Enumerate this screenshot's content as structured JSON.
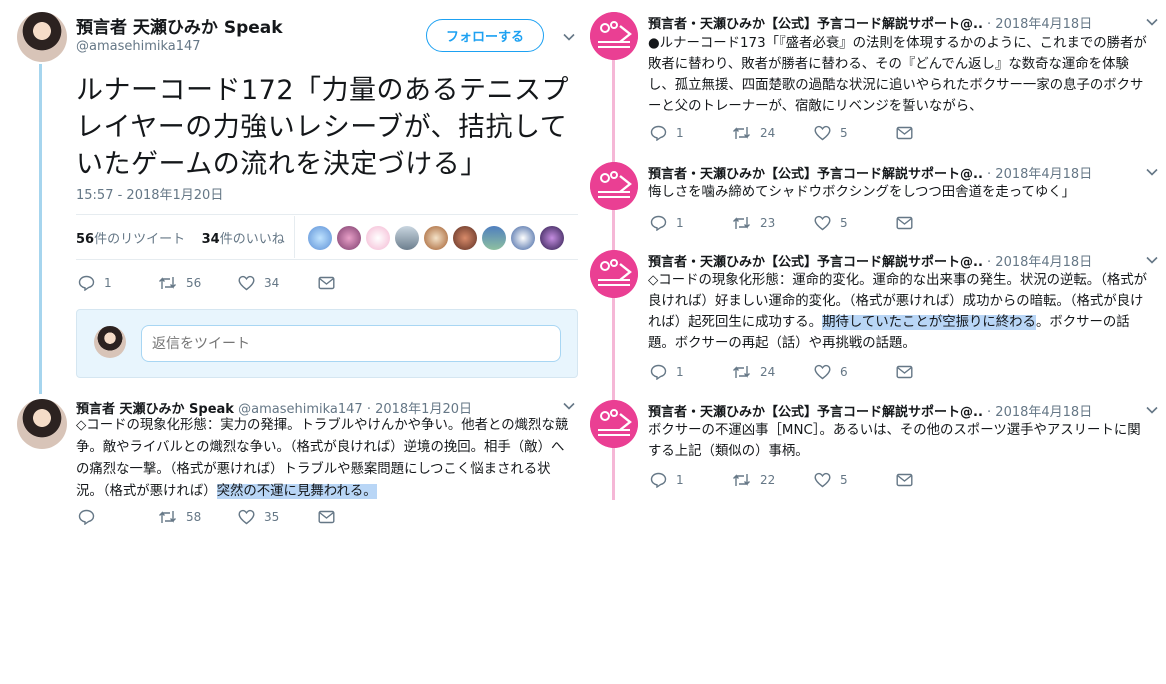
{
  "main_tweet": {
    "author_name": "預言者 天瀬ひみか Speak",
    "handle": "@amasehimika147",
    "follow_label": "フォローする",
    "text": "ルナーコード172「力量のあるテニスプレイヤーの力強いレシーブが、拮抗していたゲームの流れを決定づける」",
    "timestamp": "15:57 - 2018年1月20日",
    "retweet_count": "56",
    "retweet_label": "件のリツイート",
    "like_count": "34",
    "like_label": "件のいいね",
    "actions": {
      "reply": "1",
      "retweet": "56",
      "like": "34"
    }
  },
  "reply_box": {
    "placeholder": "返信をツイート"
  },
  "reply_tweet": {
    "author_name": "預言者 天瀬ひみか Speak",
    "handle": "@amasehimika147",
    "date": "· 2018年1月20日",
    "text_plain": "◇コードの現象化形態：実力の発揮。トラブルやけんかや争い。他者との熾烈な競争。敵やライバルとの熾烈な争い。（格式が良ければ）逆境の挽回。相手（敵）への痛烈な一撃。（格式が悪ければ）トラブルや懸案問題にしつこく悩まされる状況。（格式が悪ければ）",
    "text_highlight": "突然の不運に見舞われる。",
    "actions": {
      "reply": "",
      "retweet": "58",
      "like": "35"
    }
  },
  "right_tweets": [
    {
      "author_name": "預言者・天瀬ひみか【公式】予言コード解説サポート@..",
      "date": "· 2018年4月18日",
      "text_plain": "●ルナーコード173「『盛者必衰』の法則を体現するかのように、これまでの勝者が敗者に替わり、敗者が勝者に替わる、その『どんでん返し』な数奇な運命を体験し、孤立無援、四面楚歌の過酷な状況に追いやられたボクサー一家の息子のボクサーと父のトレーナーが、宿敵にリベンジを誓いながら、",
      "text_highlight": "",
      "text_after": "",
      "actions": {
        "reply": "1",
        "retweet": "24",
        "like": "5"
      }
    },
    {
      "author_name": "預言者・天瀬ひみか【公式】予言コード解説サポート@..",
      "date": "· 2018年4月18日",
      "text_plain": "悔しさを噛み締めてシャドウボクシングをしつつ田舎道を走ってゆく」",
      "text_highlight": "",
      "text_after": "",
      "actions": {
        "reply": "1",
        "retweet": "23",
        "like": "5"
      }
    },
    {
      "author_name": "預言者・天瀬ひみか【公式】予言コード解説サポート@..",
      "date": "· 2018年4月18日",
      "text_plain": "◇コードの現象化形態：運命的変化。運命的な出来事の発生。状況の逆転。（格式が良ければ）好ましい運命的変化。（格式が悪ければ）成功からの暗転。（格式が良ければ）起死回生に成功する。",
      "text_highlight": "期待していたことが空振りに終わる",
      "text_after": "。ボクサーの話題。ボクサーの再起（話）や再挑戦の話題。",
      "actions": {
        "reply": "1",
        "retweet": "24",
        "like": "6"
      }
    },
    {
      "author_name": "預言者・天瀬ひみか【公式】予言コード解説サポート@..",
      "date": "· 2018年4月18日",
      "text_plain": "ボクサーの不運凶事［MNC］。あるいは、その他のスポーツ選手やアスリートに関する上記（類似の）事柄。",
      "text_highlight": "",
      "text_after": "",
      "actions": {
        "reply": "1",
        "retweet": "22",
        "like": "5"
      }
    }
  ],
  "colors": {
    "link_blue": "#1da1f2",
    "thread_blue": "#a6d5ee",
    "thread_pink": "#f5b7d6",
    "brand_pink": "#ea3f93",
    "highlight": "#b9d6f6",
    "muted_text": "#657786"
  },
  "icons": [
    "reply-icon",
    "retweet-icon",
    "like-icon",
    "dm-icon",
    "chevron-down-icon"
  ]
}
